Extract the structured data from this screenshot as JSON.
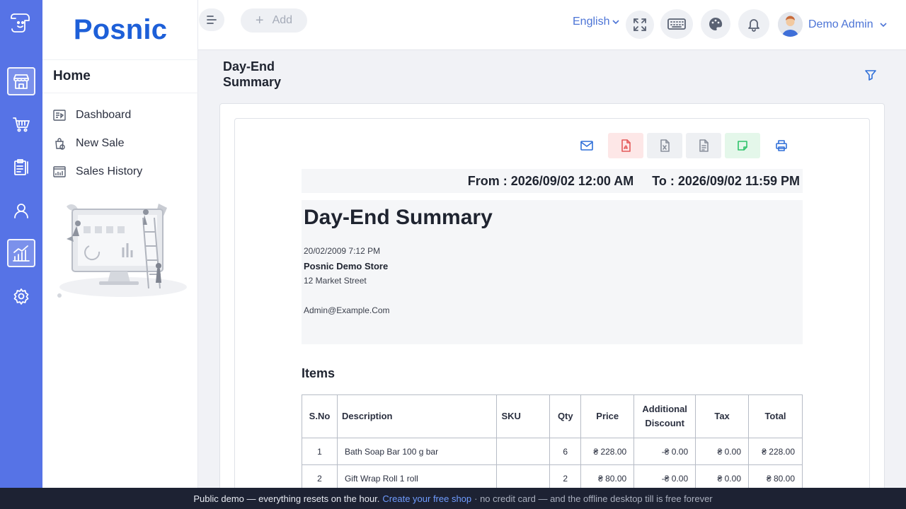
{
  "app": {
    "brand": "Posnic"
  },
  "sidebar": {
    "section_title": "Home",
    "items": [
      {
        "label": "Dashboard",
        "icon": "dashboard-icon"
      },
      {
        "label": "New Sale",
        "icon": "new-sale-icon"
      },
      {
        "label": "Sales History",
        "icon": "sales-history-icon"
      }
    ]
  },
  "rail": {
    "items": [
      {
        "icon": "store-icon",
        "active": true
      },
      {
        "icon": "cart-icon",
        "active": false
      },
      {
        "icon": "clipboard-icon",
        "active": false
      },
      {
        "icon": "user-icon",
        "active": false
      },
      {
        "icon": "chart-icon",
        "active": true
      },
      {
        "icon": "gear-icon",
        "active": false
      }
    ]
  },
  "topbar": {
    "add_label": "Add",
    "language": "English",
    "user_name": "Demo Admin"
  },
  "page": {
    "title": "Day-End Summary"
  },
  "report": {
    "from_label": "From : 2026/09/02 12:00 AM",
    "to_label": "To : 2026/09/02 11:59 PM",
    "title": "Day-End Summary",
    "datetime": "20/02/2009 7:12 PM",
    "store_name": "Posnic Demo Store",
    "address": "12 Market Street",
    "email": "Admin@Example.Com"
  },
  "items": {
    "title": "Items",
    "columns": [
      "S.No",
      "Description",
      "SKU",
      "Qty",
      "Price",
      "Additional Discount",
      "Tax",
      "Total"
    ],
    "rows": [
      {
        "sno": "1",
        "description": "Bath Soap Bar 100 g bar",
        "sku": "",
        "qty": "6",
        "price": "₴ 228.00",
        "discount": "-₴ 0.00",
        "tax": "₴ 0.00",
        "total": "₴ 228.00"
      },
      {
        "sno": "2",
        "description": "Gift Wrap Roll 1 roll",
        "sku": "",
        "qty": "2",
        "price": "₴ 80.00",
        "discount": "-₴ 0.00",
        "tax": "₴ 0.00",
        "total": "₴ 80.00"
      }
    ]
  },
  "banner": {
    "text_main": "Public demo — everything resets on the hour.",
    "link_text": "Create your free shop",
    "text_muted": "· no credit card — and the offline desktop till is free forever"
  },
  "colors": {
    "rail": "#5673e6",
    "brand": "#1d5fd8",
    "link": "#4c74d6",
    "banner": "#1d2233"
  }
}
